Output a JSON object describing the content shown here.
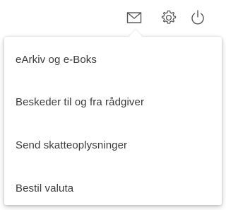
{
  "header": {
    "icons": {
      "mail": "mail-icon",
      "settings": "gear-icon",
      "power": "power-icon"
    },
    "icon_color": "#555555"
  },
  "menu": {
    "items": [
      {
        "label": "eArkiv og e-Boks"
      },
      {
        "label": "Beskeder til og fra rådgiver"
      },
      {
        "label": "Send skatteoplysninger"
      },
      {
        "label": "Bestil valuta"
      }
    ]
  }
}
